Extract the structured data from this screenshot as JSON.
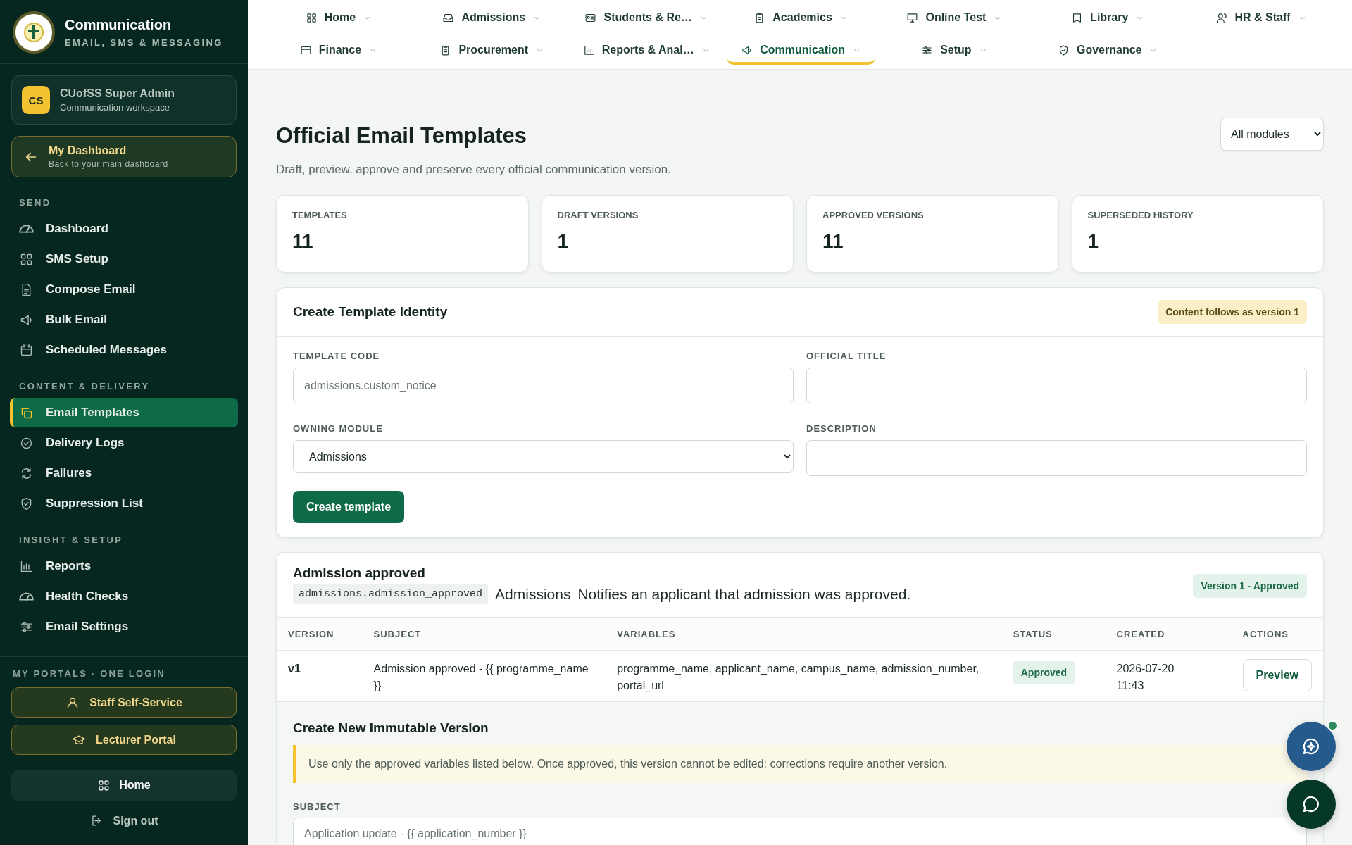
{
  "brand": {
    "title": "Communication",
    "subtitle": "EMAIL, SMS & MESSAGING"
  },
  "user": {
    "initials": "CS",
    "name": "CUofSS Super Admin",
    "workspace": "Communication workspace"
  },
  "back_link": {
    "title": "My Dashboard",
    "subtitle": "Back to your main dashboard"
  },
  "sidebar": {
    "sections": [
      {
        "heading": "SEND",
        "items": [
          {
            "label": "Dashboard",
            "selected": false
          },
          {
            "label": "SMS Setup",
            "selected": false
          },
          {
            "label": "Compose Email",
            "selected": false
          },
          {
            "label": "Bulk Email",
            "selected": false
          },
          {
            "label": "Scheduled Messages",
            "selected": false
          }
        ]
      },
      {
        "heading": "CONTENT & DELIVERY",
        "items": [
          {
            "label": "Email Templates",
            "selected": true
          },
          {
            "label": "Delivery Logs",
            "selected": false
          },
          {
            "label": "Failures",
            "selected": false
          },
          {
            "label": "Suppression List",
            "selected": false
          }
        ]
      },
      {
        "heading": "INSIGHT & SETUP",
        "items": [
          {
            "label": "Reports",
            "selected": false
          },
          {
            "label": "Health Checks",
            "selected": false
          },
          {
            "label": "Email Settings",
            "selected": false
          }
        ]
      }
    ]
  },
  "portals": {
    "heading": "MY PORTALS · ONE LOGIN",
    "items": [
      "Staff Self-Service",
      "Lecturer Portal"
    ]
  },
  "home_button": "Home",
  "sign_out": "Sign out",
  "top_nav": [
    {
      "label": "Home",
      "selected": false
    },
    {
      "label": "Admissions",
      "selected": false
    },
    {
      "label": "Students & Re…",
      "selected": false
    },
    {
      "label": "Academics",
      "selected": false
    },
    {
      "label": "Online Test",
      "selected": false
    },
    {
      "label": "Library",
      "selected": false
    },
    {
      "label": "HR & Staff",
      "selected": false
    },
    {
      "label": "Finance",
      "selected": false
    },
    {
      "label": "Procurement",
      "selected": false
    },
    {
      "label": "Reports & Anal…",
      "selected": false
    },
    {
      "label": "Communication",
      "selected": true
    },
    {
      "label": "Setup",
      "selected": false
    },
    {
      "label": "Governance",
      "selected": false
    }
  ],
  "page": {
    "title": "Official Email Templates",
    "subtitle": "Draft, preview, approve and preserve every official communication version.",
    "module_filter": "All modules"
  },
  "stats": [
    {
      "label": "TEMPLATES",
      "value": "11"
    },
    {
      "label": "DRAFT VERSIONS",
      "value": "1"
    },
    {
      "label": "APPROVED VERSIONS",
      "value": "11"
    },
    {
      "label": "SUPERSEDED HISTORY",
      "value": "1"
    }
  ],
  "create_form": {
    "title": "Create Template Identity",
    "badge": "Content follows as version 1",
    "fields": [
      {
        "label": "TEMPLATE CODE",
        "kind": "text",
        "placeholder": "admissions.custom_notice"
      },
      {
        "label": "OFFICIAL TITLE",
        "kind": "text"
      },
      {
        "label": "OWNING MODULE",
        "kind": "select",
        "value": "Admissions"
      },
      {
        "label": "DESCRIPTION",
        "kind": "text"
      }
    ],
    "button": "Create template"
  },
  "template": {
    "title": "Admission approved",
    "code": "admissions.admission_approved",
    "module": "Admissions",
    "description": "Notifies an applicant that admission was approved.",
    "badge": "Version 1 - Approved",
    "table": {
      "columns": [
        "VERSION",
        "SUBJECT",
        "VARIABLES",
        "STATUS",
        "CREATED",
        "ACTIONS"
      ],
      "rows": [
        {
          "version": "v1",
          "subject": "Admission approved - {{ programme_name }}",
          "variables": "programme_name, applicant_name, campus_name, admission_number, portal_url",
          "status": "Approved",
          "created": "2026-07-20 11:43",
          "action": "Preview"
        }
      ]
    }
  },
  "new_version": {
    "title": "Create New Immutable Version",
    "notice": "Use only the approved variables listed below. Once approved, this version cannot be edited; corrections require another version.",
    "field": {
      "label": "SUBJECT",
      "placeholder": "Application update - {{ application_number }}"
    }
  }
}
